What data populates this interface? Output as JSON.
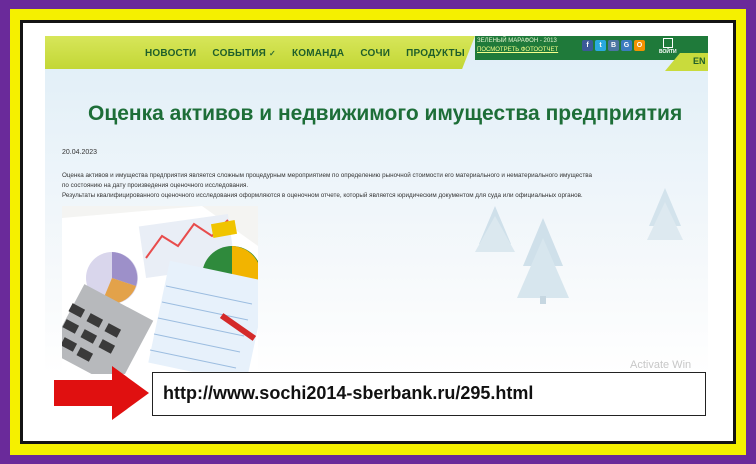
{
  "nav": {
    "items": [
      "НОВОСТИ",
      "СОБЫТИЯ",
      "КОМАНДА",
      "СОЧИ",
      "ПРОДУКТЫ"
    ]
  },
  "header": {
    "marathon_text": "ЗЕЛЕНЫЙ МАРАФОН - 2013",
    "photo_report_link": "ПОСМОТРЕТЬ ФОТООТЧЕТ",
    "social": [
      "f",
      "t",
      "В",
      "G",
      "О"
    ],
    "login_label": "ВОЙТИ",
    "lang": "EN"
  },
  "page": {
    "title": "Оценка активов и недвижимого имущества предприятия",
    "date": "20.04.2023",
    "paragraph_lines": [
      "Оценка активов и имущества предприятия является сложным процедурным мероприятием по определению рыночной стоимости его материального и нематериального имущества",
      "по состоянию на дату произведения оценочного исследования.",
      "Результаты квалифицированного оценочного исследования оформляются в оценочном отчете, который является юридическим документом для суда или официальных органов."
    ],
    "watermark": "Activate Win"
  },
  "annotation": {
    "url": "http://www.sochi2014-sberbank.ru/295.html"
  },
  "colors": {
    "frame_outer": "#6a2a9a",
    "frame_yellow": "#f5f000",
    "nav_green": "#c3d735",
    "title_green": "#1d6e38",
    "arrow_red": "#e01010"
  }
}
